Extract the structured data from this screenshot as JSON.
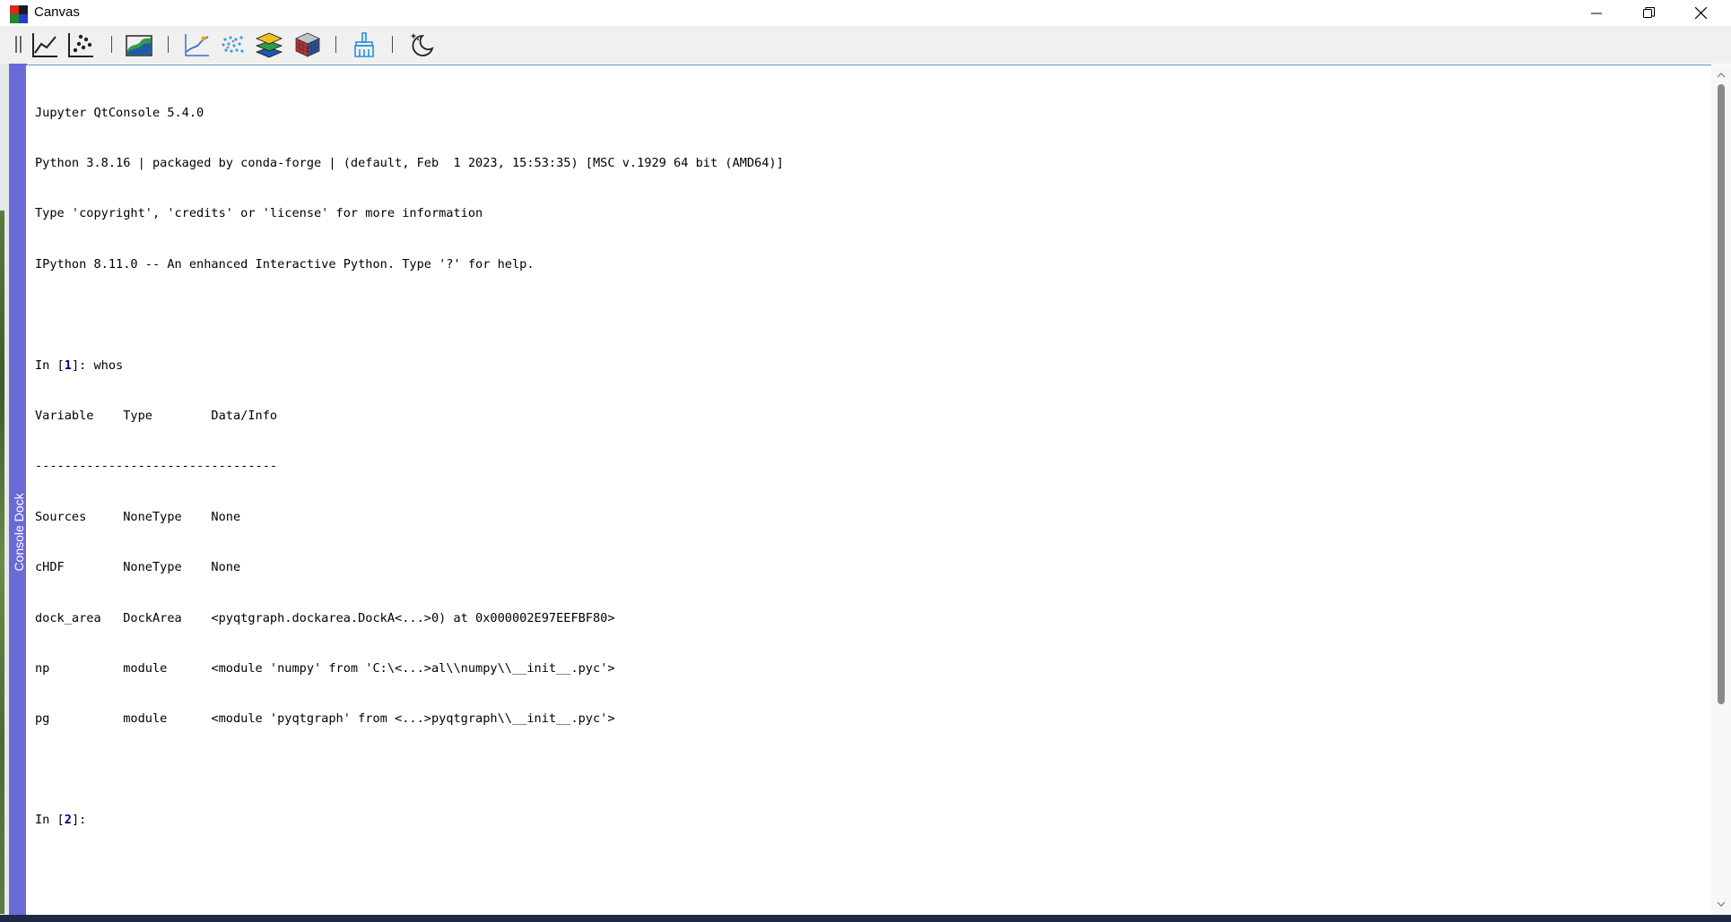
{
  "window": {
    "title": "Canvas",
    "controls": [
      "minimize",
      "restore",
      "close"
    ]
  },
  "toolbar": {
    "items": [
      {
        "name": "line-plot-icon"
      },
      {
        "name": "scatter-plot-icon"
      },
      {
        "name": "surface-plot-icon"
      },
      {
        "name": "curve-plot-icon"
      },
      {
        "name": "point-cloud-icon"
      },
      {
        "name": "layers-icon"
      },
      {
        "name": "voxel-cube-icon"
      },
      {
        "name": "clear-brush-icon"
      },
      {
        "name": "night-mode-icon"
      }
    ]
  },
  "dock": {
    "tab_label": "Console Dock"
  },
  "console": {
    "banner": [
      "Jupyter QtConsole 5.4.0",
      "Python 3.8.16 | packaged by conda-forge | (default, Feb  1 2023, 15:53:35) [MSC v.1929 64 bit (AMD64)]",
      "Type 'copyright', 'credits' or 'license' for more information",
      "IPython 8.11.0 -- An enhanced Interactive Python. Type '?' for help."
    ],
    "prompt1": {
      "prefix": "In [",
      "number": "1",
      "suffix": "]: ",
      "command": "whos"
    },
    "whos_header": "Variable    Type        Data/Info",
    "whos_rule": "---------------------------------",
    "whos_rows": [
      "Sources     NoneType    None",
      "cHDF        NoneType    None",
      "dock_area   DockArea    <pyqtgraph.dockarea.DockA<...>0) at 0x000002E97EEFBF80>",
      "np          module      <module 'numpy' from 'C:\\<...>al\\\\numpy\\\\__init__.pyc'>",
      "pg          module      <module 'pyqtgraph' from <...>pyqtgraph\\\\__init__.pyc'>"
    ],
    "prompt2": {
      "prefix": "In [",
      "number": "2",
      "suffix": "]: "
    }
  },
  "colors": {
    "dock_tab": "#6a6ad6",
    "prompt_number": "#000080",
    "console_border": "#5a90d0"
  }
}
